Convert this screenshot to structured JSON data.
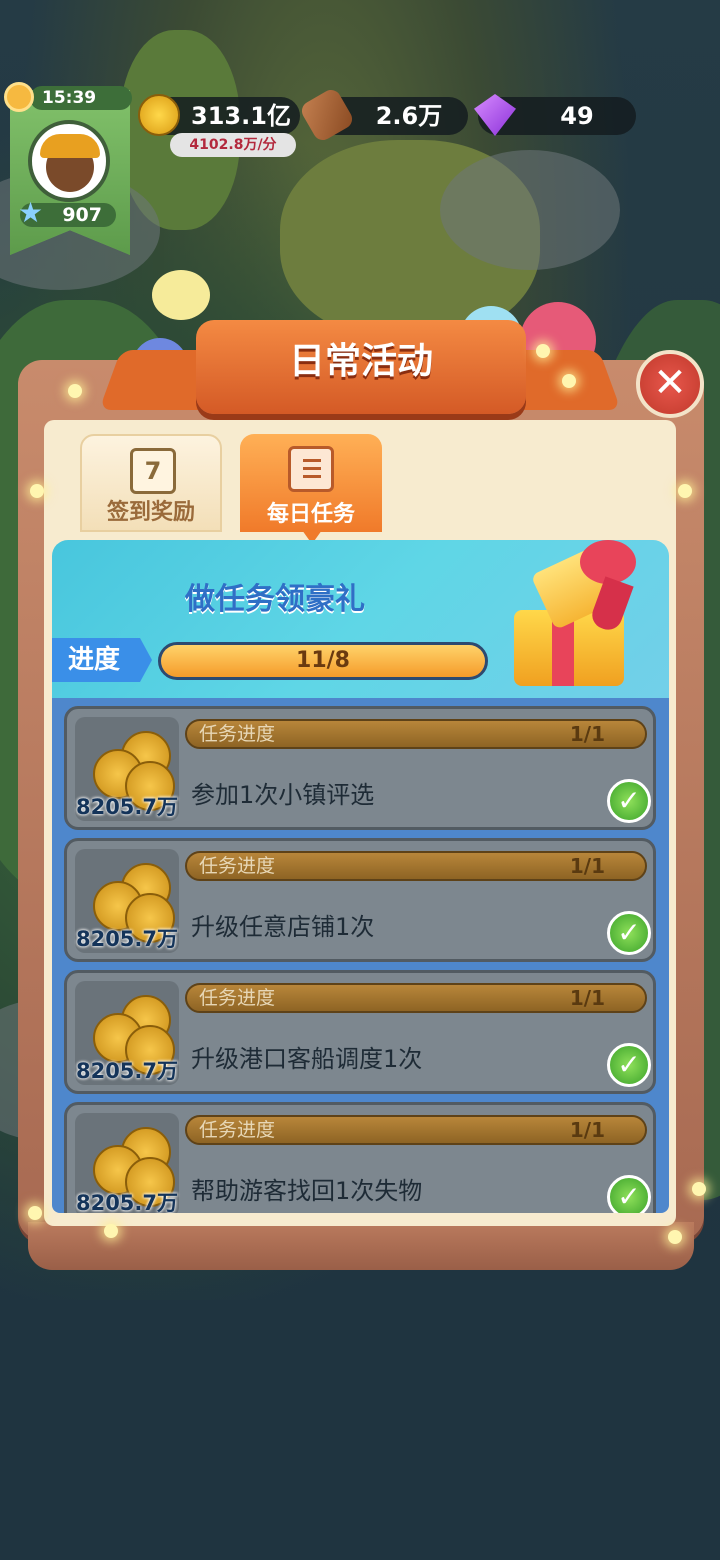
{
  "hud": {
    "time": "15:39",
    "level": "907",
    "coins": "313.1亿",
    "coin_rate": "4102.8万/分",
    "wood": "2.6万",
    "gems": "49"
  },
  "panel": {
    "title": "日常活动",
    "tabs": [
      {
        "label": "签到奖励",
        "icon_text": "7"
      },
      {
        "label": "每日任务"
      }
    ],
    "banner_title": "做任务领豪礼",
    "progress_label": "进度",
    "progress_text": "11/8",
    "progress_fraction": 1.0
  },
  "tasks": [
    {
      "progress_label": "任务进度",
      "progress": "1/1",
      "description": "参加1次小镇评选",
      "reward": "8205.7万"
    },
    {
      "progress_label": "任务进度",
      "progress": "1/1",
      "description": "升级任意店铺1次",
      "reward": "8205.7万"
    },
    {
      "progress_label": "任务进度",
      "progress": "1/1",
      "description": "升级港口客船调度1次",
      "reward": "8205.7万"
    },
    {
      "progress_label": "任务进度",
      "progress": "1/1",
      "description": "帮助游客找回1次失物",
      "reward": "8205.7万"
    }
  ],
  "colors": {
    "accent_orange": "#f07a2a",
    "banner_cyan": "#5fd6e6",
    "list_blue": "#4e87cc",
    "check_green": "#3aa22a"
  }
}
